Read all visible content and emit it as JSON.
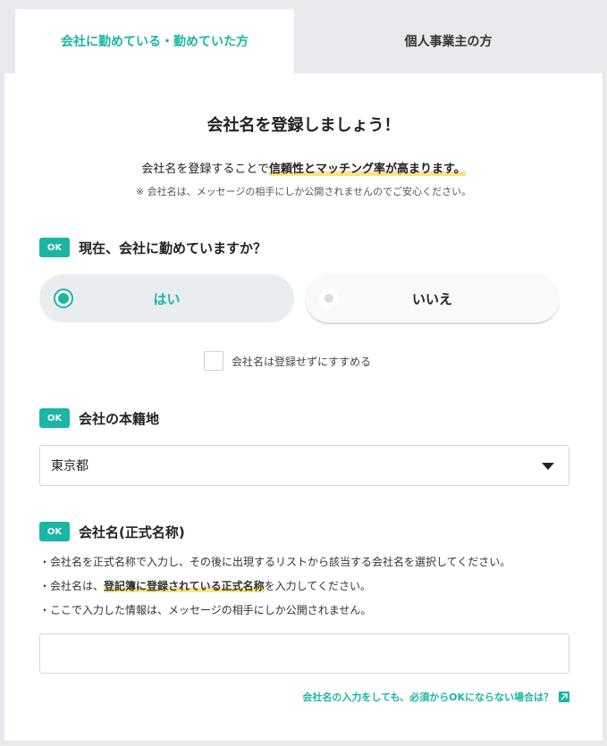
{
  "tabs": {
    "employed": "会社に勤めている・勤めていた方",
    "self_employed": "個人事業主の方"
  },
  "header": {
    "title": "会社名を登録しましょう！",
    "intro_prefix": "会社名を登録することで",
    "intro_highlight": "信頼性とマッチング率が高まります。",
    "note": "※ 会社名は、メッセージの相手にしか公開されませんのでご安心ください。"
  },
  "q_employed": {
    "badge": "OK",
    "label": "現在、会社に勤めていますか？",
    "yes_label": "はい",
    "no_label": "いいえ",
    "selected": "はい",
    "skip_label": "会社名は登録せずにすすめる",
    "skip_checked": false
  },
  "q_location": {
    "badge": "OK",
    "label": "会社の本籍地",
    "selected": "東京都"
  },
  "q_company": {
    "badge": "OK",
    "label": "会社名(正式名称)",
    "bullet1": "・会社名を正式名称で入力し、その後に出現するリストから該当する会社名を選択してください。",
    "bullet2_prefix": "・会社名は、",
    "bullet2_highlight": "登記簿に登録されている正式名称",
    "bullet2_suffix": "を入力してください。",
    "bullet3": "・ここで入力した情報は、メッセージの相手にしか公開されません。",
    "input_value": "",
    "help_link": "会社名の入力をしても、必須からOKにならない場合は？"
  },
  "colors": {
    "accent": "#1cb5a3",
    "highlight": "#fbe38a"
  },
  "icons": {
    "external_link": "external-link-icon",
    "caret": "caret-down-icon"
  }
}
